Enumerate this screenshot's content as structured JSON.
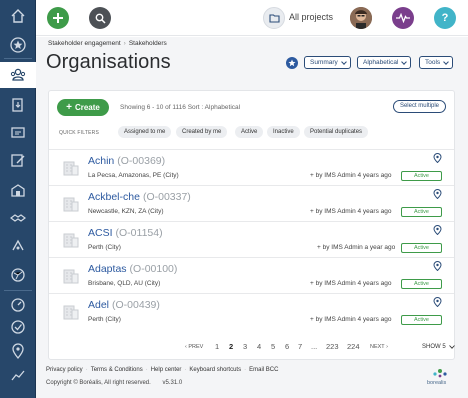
{
  "topbar": {
    "projects_label": "All projects",
    "help_label": "?"
  },
  "breadcrumb": [
    "Stakeholder engagement",
    "Stakeholders"
  ],
  "page": {
    "title": "Organisations"
  },
  "view_controls": {
    "summary_label": "Summary",
    "sort_label": "Alphabetical",
    "tools_label": "Tools"
  },
  "list": {
    "create_label": "Create",
    "showing_text": "Showing 6 - 10 of 1116 Sort : Alphabetical",
    "select_multiple_label": "Select multiple",
    "quick_filters_label": "QUICK FILTERS",
    "filters": [
      "Assigned to me",
      "Created by me",
      "Active",
      "Inactive",
      "Potential duplicates"
    ],
    "rows": [
      {
        "name": "Achin",
        "code": "(O-00369)",
        "location": "La Pecsa, Amazonas, PE (City)",
        "by": "by IMS Admin 4 years ago",
        "status": "Active"
      },
      {
        "name": "Ackbel-che",
        "code": "(O-00337)",
        "location": "Newcastle, KZN, ZA (City)",
        "by": "by IMS Admin 4 years ago",
        "status": "Active"
      },
      {
        "name": "ACSI",
        "code": "(O-01154)",
        "location": "Perth (City)",
        "by": "by IMS Admin a year ago",
        "status": "Active"
      },
      {
        "name": "Adaptas",
        "code": "(O-00100)",
        "location": "Brisbane, QLD, AU (City)",
        "by": "by IMS Admin 4 years ago",
        "status": "Active"
      },
      {
        "name": "Adel",
        "code": "(O-00439)",
        "location": "Perth (City)",
        "by": "by IMS Admin 4 years ago",
        "status": "Active"
      }
    ]
  },
  "pagination": {
    "prev_label": "‹ PREV",
    "pages": [
      "1",
      "2",
      "3",
      "4",
      "5",
      "6",
      "7",
      "...",
      "223",
      "224"
    ],
    "current_page": "2",
    "next_label": "NEXT ›",
    "show_label": "SHOW 5"
  },
  "footer": {
    "links": [
      "Privacy policy",
      "Terms & Conditions",
      "Help center",
      "Keyboard shortcuts",
      "Email BCC"
    ],
    "copyright": "Copyright © Boréalis, All right reserved.",
    "version": "v5.31.0",
    "logo_text": "borealis"
  },
  "colors": {
    "sidebar": "#27476a",
    "accent_green": "#3e9b49",
    "link_blue": "#2d5aa0",
    "help_teal": "#41b4c8",
    "pulse_purple": "#7a3e8c"
  },
  "sidebar_icons": [
    "home-icon",
    "star-icon",
    "stakeholders-icon",
    "import-icon",
    "grievance-icon",
    "engagement-icon",
    "building-icon",
    "handshake-icon",
    "commitment-icon",
    "map-icon",
    "dashboard-icon",
    "check-circle-icon",
    "location-icon",
    "chart-icon"
  ]
}
